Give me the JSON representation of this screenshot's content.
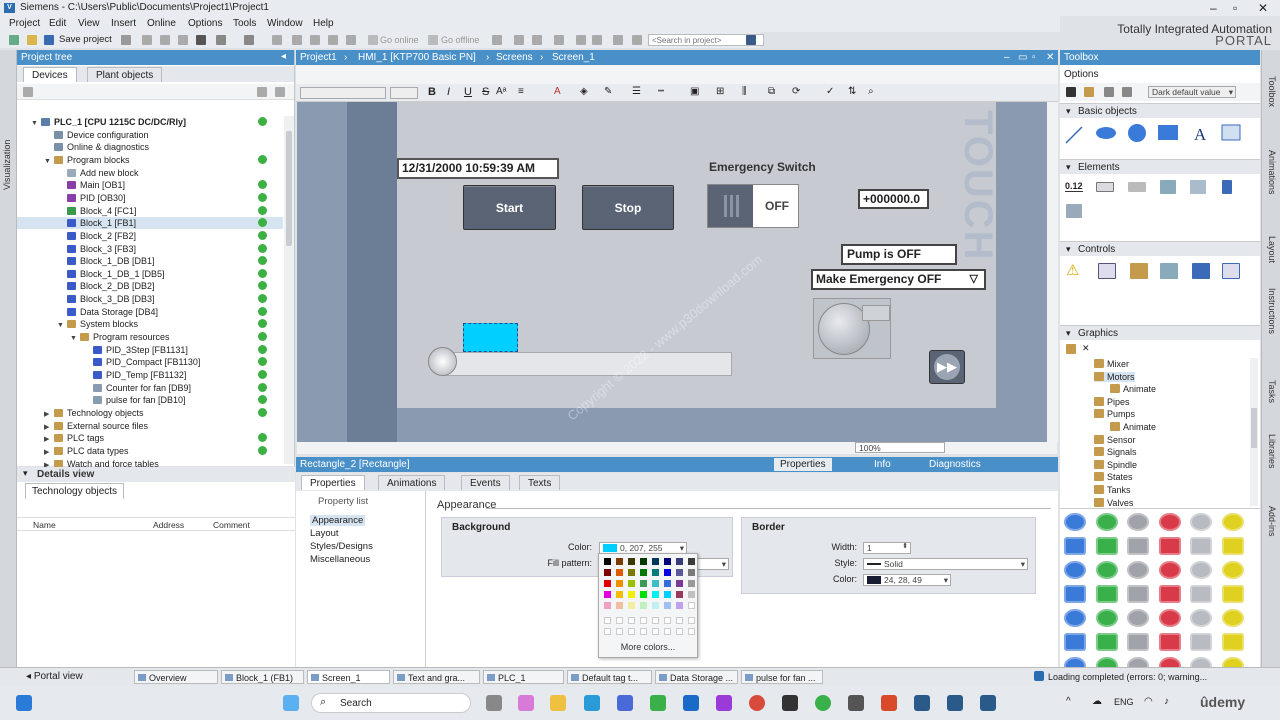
{
  "window": {
    "title": "Siemens - C:\\Users\\Public\\Documents\\Project1\\Project1",
    "brand_line1": "Totally Integrated Automation",
    "brand_line2": "PORTAL"
  },
  "menu": [
    "Project",
    "Edit",
    "View",
    "Insert",
    "Online",
    "Options",
    "Tools",
    "Window",
    "Help"
  ],
  "toolbar": {
    "save_label": "Save project",
    "go_online": "Go online",
    "go_offline": "Go offline",
    "search_placeholder": "<Search in project>"
  },
  "project_tree": {
    "title": "Project tree",
    "tabs": [
      "Devices",
      "Plant objects"
    ],
    "items": [
      {
        "label": "PLC_1 [CPU 1215C DC/DC/Rly]",
        "indent": 0,
        "color": "#5a7ea8",
        "status": true
      },
      {
        "label": "Device configuration",
        "indent": 1,
        "color": "#7a8fa8",
        "status": false
      },
      {
        "label": "Online & diagnostics",
        "indent": 1,
        "color": "#7a8fa8",
        "status": false
      },
      {
        "label": "Program blocks",
        "indent": 1,
        "color": "#c49a4c",
        "status": true
      },
      {
        "label": "Add new block",
        "indent": 2,
        "color": "#9ab",
        "status": false
      },
      {
        "label": "Main [OB1]",
        "indent": 2,
        "color": "#8a3fa8",
        "status": true
      },
      {
        "label": "PID [OB30]",
        "indent": 2,
        "color": "#8a3fa8",
        "status": true
      },
      {
        "label": "Block_4 [FC1]",
        "indent": 2,
        "color": "#3a9a4a",
        "status": true
      },
      {
        "label": "Block_1 [FB1]",
        "indent": 2,
        "color": "#3a5ac8",
        "status": true
      },
      {
        "label": "Block_2 [FB2]",
        "indent": 2,
        "color": "#3a5ac8",
        "status": true
      },
      {
        "label": "Block_3 [FB3]",
        "indent": 2,
        "color": "#3a5ac8",
        "status": true
      },
      {
        "label": "Block_1_DB [DB1]",
        "indent": 2,
        "color": "#3a5ac8",
        "status": true
      },
      {
        "label": "Block_1_DB_1 [DB5]",
        "indent": 2,
        "color": "#3a5ac8",
        "status": true
      },
      {
        "label": "Block_2_DB [DB2]",
        "indent": 2,
        "color": "#3a5ac8",
        "status": true
      },
      {
        "label": "Block_3_DB [DB3]",
        "indent": 2,
        "color": "#3a5ac8",
        "status": true
      },
      {
        "label": "Data Storage [DB4]",
        "indent": 2,
        "color": "#3a5ac8",
        "status": true
      },
      {
        "label": "System blocks",
        "indent": 2,
        "color": "#c49a4c",
        "status": true
      },
      {
        "label": "Program resources",
        "indent": 3,
        "color": "#c49a4c",
        "status": true
      },
      {
        "label": "PID_3Step [FB1131]",
        "indent": 4,
        "color": "#3a5ac8",
        "status": true
      },
      {
        "label": "PID_Compact [FB1130]",
        "indent": 4,
        "color": "#3a5ac8",
        "status": true
      },
      {
        "label": "PID_Temp [FB1132]",
        "indent": 4,
        "color": "#3a5ac8",
        "status": true
      },
      {
        "label": "Counter for fan [DB9]",
        "indent": 4,
        "color": "#8a9ab0",
        "status": true
      },
      {
        "label": "pulse for fan [DB10]",
        "indent": 4,
        "color": "#8a9ab0",
        "status": true
      },
      {
        "label": "Technology objects",
        "indent": 1,
        "color": "#c49a4c",
        "status": true
      },
      {
        "label": "External source files",
        "indent": 1,
        "color": "#c49a4c",
        "status": false
      },
      {
        "label": "PLC tags",
        "indent": 1,
        "color": "#c49a4c",
        "status": true
      },
      {
        "label": "PLC data types",
        "indent": 1,
        "color": "#c49a4c",
        "status": true
      },
      {
        "label": "Watch and force tables",
        "indent": 1,
        "color": "#c49a4c",
        "status": false
      }
    ]
  },
  "details": {
    "title": "Details view",
    "tab": "Technology objects",
    "columns": [
      "Name",
      "Address",
      "Comment"
    ]
  },
  "side_strip": {
    "label": "Visualization"
  },
  "editor": {
    "breadcrumb": [
      "Project1",
      "HMI_1 [KTP700 Basic PN]",
      "Screens",
      "Screen_1"
    ],
    "zoom": "100%",
    "hmi": {
      "datetime": "12/31/2000 10:59:39 AM",
      "start": "Start",
      "stop": "Stop",
      "emergency_title": "Emergency Switch",
      "switch_state": "OFF",
      "numeric": "+000000.0",
      "pump_status": "Pump is OFF",
      "emergency_dropdown": "Make Emergency OFF",
      "touch_label": "TOUCH",
      "rect_color": "#00cfff"
    },
    "watermark": "Copyright © 2022 - www.p30download.com"
  },
  "properties": {
    "object_title": "Rectangle_2 [Rectangle]",
    "head_tabs": [
      "Properties",
      "Info",
      "Diagnostics"
    ],
    "tabs": [
      "Properties",
      "Animations",
      "Events",
      "Texts"
    ],
    "nav_title": "Property list",
    "nav": [
      "Appearance",
      "Layout",
      "Styles/Designs",
      "Miscellaneous"
    ],
    "section_title": "Appearance",
    "background": {
      "title": "Background",
      "color_label": "Color:",
      "color_value": "0, 207, 255",
      "fill_label": "Fill pattern:"
    },
    "border": {
      "title": "Border",
      "width_label": "Width:",
      "width_value": "1",
      "style_label": "Style:",
      "style_value": "Solid",
      "color_label": "Color:",
      "color_value": "24, 28, 49"
    },
    "palette_more": "More colors..."
  },
  "toolbox": {
    "title": "Toolbox",
    "options_label": "Options",
    "theme": "Dark default value",
    "sections": [
      "Basic objects",
      "Elements",
      "Controls",
      "Graphics"
    ],
    "graphics_items": [
      {
        "label": "Mixer",
        "indent": 1
      },
      {
        "label": "Motors",
        "indent": 1
      },
      {
        "label": "Animate",
        "indent": 2
      },
      {
        "label": "Pipes",
        "indent": 1
      },
      {
        "label": "Pumps",
        "indent": 1
      },
      {
        "label": "Animate",
        "indent": 2
      },
      {
        "label": "Sensor",
        "indent": 1
      },
      {
        "label": "Signals",
        "indent": 1
      },
      {
        "label": "Spindle",
        "indent": 1
      },
      {
        "label": "States",
        "indent": 1
      },
      {
        "label": "Tanks",
        "indent": 1
      },
      {
        "label": "Valves",
        "indent": 1
      }
    ],
    "element_value": "0.12"
  },
  "right_strip": [
    "Toolbox",
    "Animations",
    "Layout",
    "Instructions",
    "Tasks",
    "Libraries",
    "Add-ins"
  ],
  "statusbar": {
    "portal_view": "Portal view",
    "tabs": [
      "Overview",
      "Block_1 (FB1)",
      "Screen_1",
      "Text and gra...",
      "PLC_1",
      "Default tag t...",
      "Data Storage ...",
      "pulse for fan ..."
    ],
    "message": "Loading completed (errors: 0; warning..."
  },
  "taskbar": {
    "search": "Search",
    "lang": "ENG",
    "udemy": "ûdemy"
  }
}
